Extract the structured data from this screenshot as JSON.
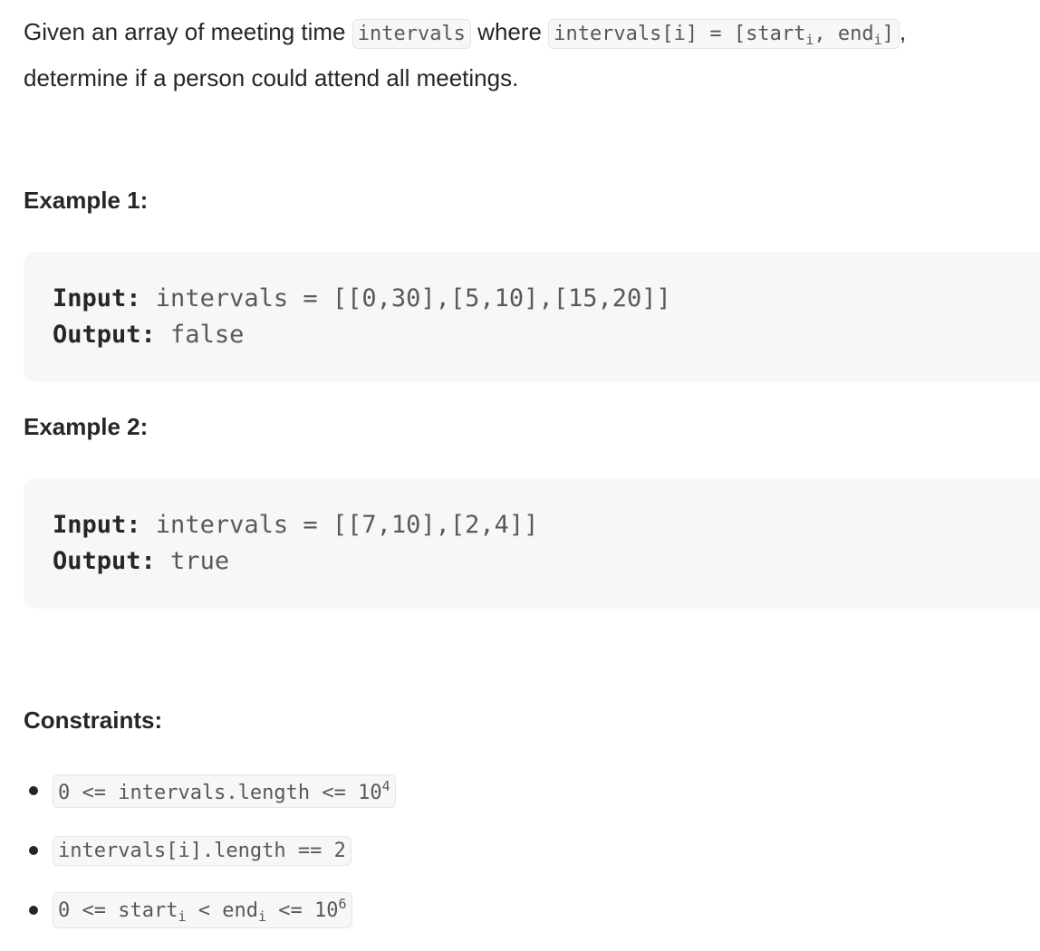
{
  "description": {
    "part1": "Given an array of meeting time ",
    "code1": "intervals",
    "part2": " where ",
    "code2_prefix": "intervals[i] = [start",
    "code2_sub1": "i",
    "code2_mid": ", end",
    "code2_sub2": "i",
    "code2_suffix": "]",
    "part3": ",",
    "line2": "determine if a person could attend all meetings."
  },
  "examples": [
    {
      "title": "Example 1:",
      "input_label": "Input:",
      "input_value": " intervals = [[0,30],[5,10],[15,20]]",
      "output_label": "Output:",
      "output_value": " false"
    },
    {
      "title": "Example 2:",
      "input_label": "Input:",
      "input_value": " intervals = [[7,10],[2,4]]",
      "output_label": "Output:",
      "output_value": " true"
    }
  ],
  "constraints": {
    "title": "Constraints:",
    "items": [
      {
        "text": "0 <= intervals.length <= 10",
        "sup": "4"
      },
      {
        "text": "intervals[i].length == 2"
      },
      {
        "pre": "0 <= start",
        "sub1": "i",
        "mid": " < end",
        "sub2": "i",
        "post": " <= 10",
        "sup": "6"
      }
    ]
  }
}
